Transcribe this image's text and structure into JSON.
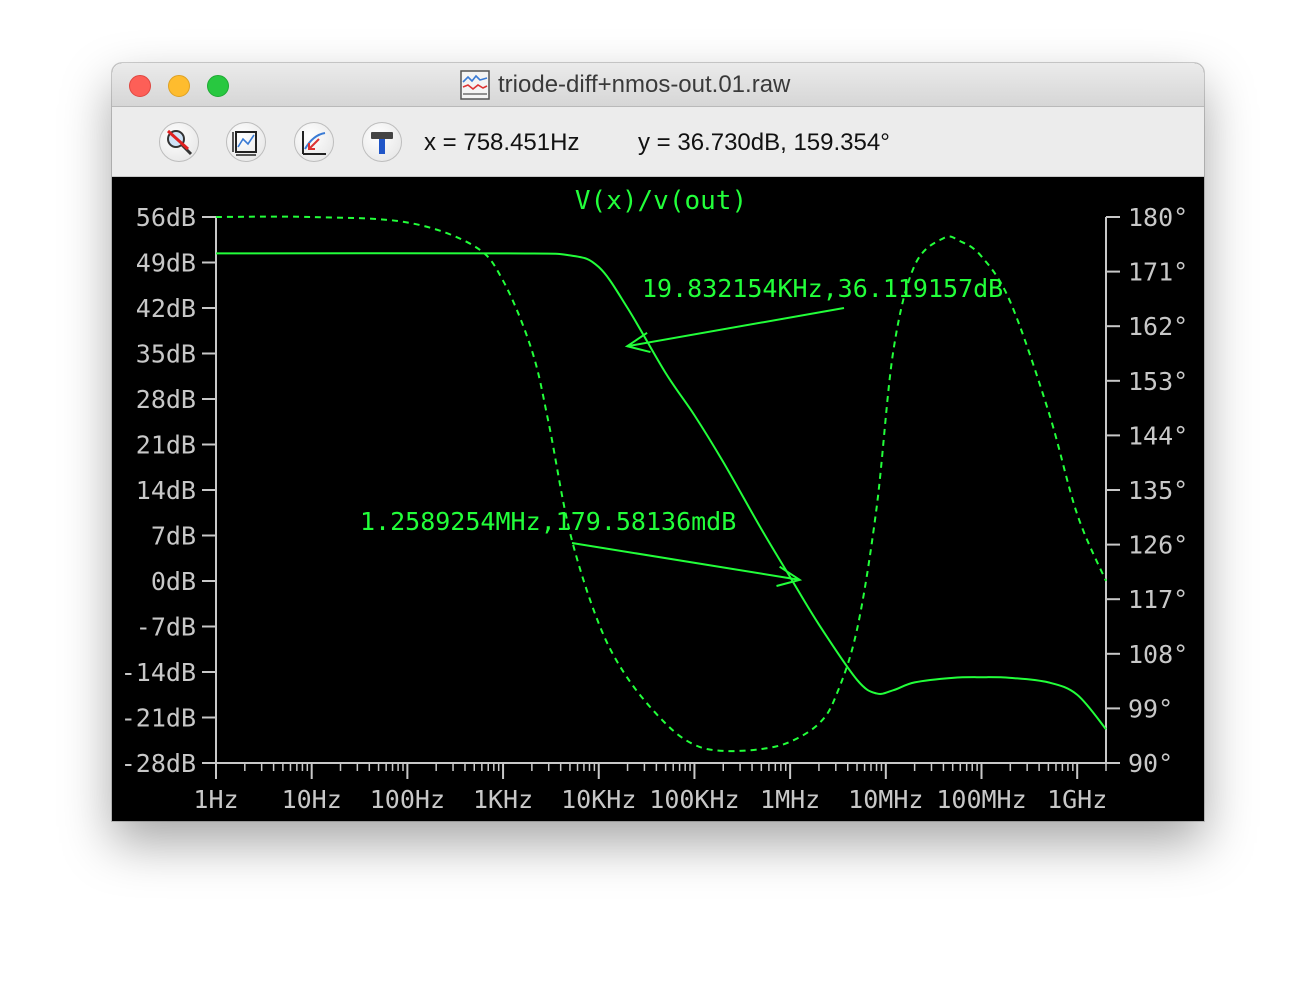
{
  "window": {
    "title": "triode-diff+nmos-out.01.raw"
  },
  "toolbar": {
    "tools": [
      {
        "icon": "zoom-cancel-icon"
      },
      {
        "icon": "autorange-icon"
      },
      {
        "icon": "cursor-step-icon"
      },
      {
        "icon": "hammer-icon"
      }
    ],
    "cursor_x": "x = 758.451Hz",
    "cursor_y": "y = 36.730dB, 159.354°"
  },
  "colors": {
    "trace": "#22ff3a",
    "axis": "#c8c8c8",
    "background": "#000000"
  },
  "chart_data": {
    "type": "line",
    "title": "V(x)/v(out)",
    "x_scale": "log",
    "xlim": [
      1,
      2000000000
    ],
    "x_ticks": [
      1,
      10,
      100,
      1000,
      10000,
      100000,
      1000000,
      10000000,
      100000000,
      1000000000
    ],
    "x_tick_labels": [
      "1Hz",
      "10Hz",
      "100Hz",
      "1KHz",
      "10KHz",
      "100KHz",
      "1MHz",
      "10MHz",
      "100MHz",
      "1GHz"
    ],
    "y_left_lim": [
      -28,
      56
    ],
    "y_left_ticks": [
      56,
      49,
      42,
      35,
      28,
      21,
      14,
      7,
      0,
      -7,
      -14,
      -21,
      -28
    ],
    "y_left_tick_labels": [
      "56dB",
      "49dB",
      "42dB",
      "35dB",
      "28dB",
      "21dB",
      "14dB",
      "7dB",
      "0dB",
      "-7dB",
      "-14dB",
      "-21dB",
      "-28dB"
    ],
    "y_right_lim": [
      90,
      180
    ],
    "y_right_ticks": [
      180,
      171,
      162,
      153,
      144,
      135,
      126,
      117,
      108,
      99,
      90
    ],
    "y_right_tick_labels": [
      "180°",
      "171°",
      "162°",
      "153°",
      "144°",
      "135°",
      "126°",
      "117°",
      "108°",
      "99°",
      "90°"
    ],
    "series": [
      {
        "style": "solid",
        "axis": "left",
        "x": [
          1,
          1000,
          5000,
          10000,
          20000,
          50000,
          100000,
          200000,
          500000,
          1000000,
          2000000,
          5000000,
          8000000,
          12000000,
          20000000,
          50000000,
          100000000,
          200000000,
          500000000,
          1000000000,
          2000000000
        ],
        "y": [
          50.4,
          50.4,
          50.1,
          48.3,
          42.0,
          32.0,
          25.5,
          18.3,
          8.0,
          0.6,
          -6.7,
          -15.2,
          -17.3,
          -16.8,
          -15.6,
          -14.9,
          -14.8,
          -14.9,
          -15.6,
          -17.5,
          -22.8
        ]
      },
      {
        "style": "dashed",
        "axis": "right",
        "x": [
          1,
          10,
          100,
          500,
          1000,
          2000,
          3000,
          5000,
          10000,
          20000,
          50000,
          100000,
          200000,
          500000,
          1000000,
          2000000,
          3000000,
          5000000,
          8000000,
          12000000,
          20000000,
          40000000,
          60000000,
          100000000,
          200000000,
          500000000,
          1000000000,
          2000000000
        ],
        "y": [
          180,
          180,
          179.1,
          175.2,
          169.5,
          158.0,
          146.0,
          128.0,
          113.0,
          104.0,
          96.5,
          93.0,
          92.0,
          92.3,
          93.5,
          96.5,
          101.0,
          112.0,
          132.0,
          158.0,
          172.0,
          176.5,
          176.0,
          173.5,
          166.0,
          148.0,
          131.0,
          120.0
        ]
      }
    ],
    "annotations": [
      {
        "text": "19.832154KHz,36.119157dB",
        "x": 19832.154,
        "y": 36.119157,
        "axis": "left"
      },
      {
        "text": "1.2589254MHz,179.58136mdB",
        "x": 1258925.4,
        "y": 0.17958136,
        "axis": "left"
      }
    ],
    "grid": false
  }
}
